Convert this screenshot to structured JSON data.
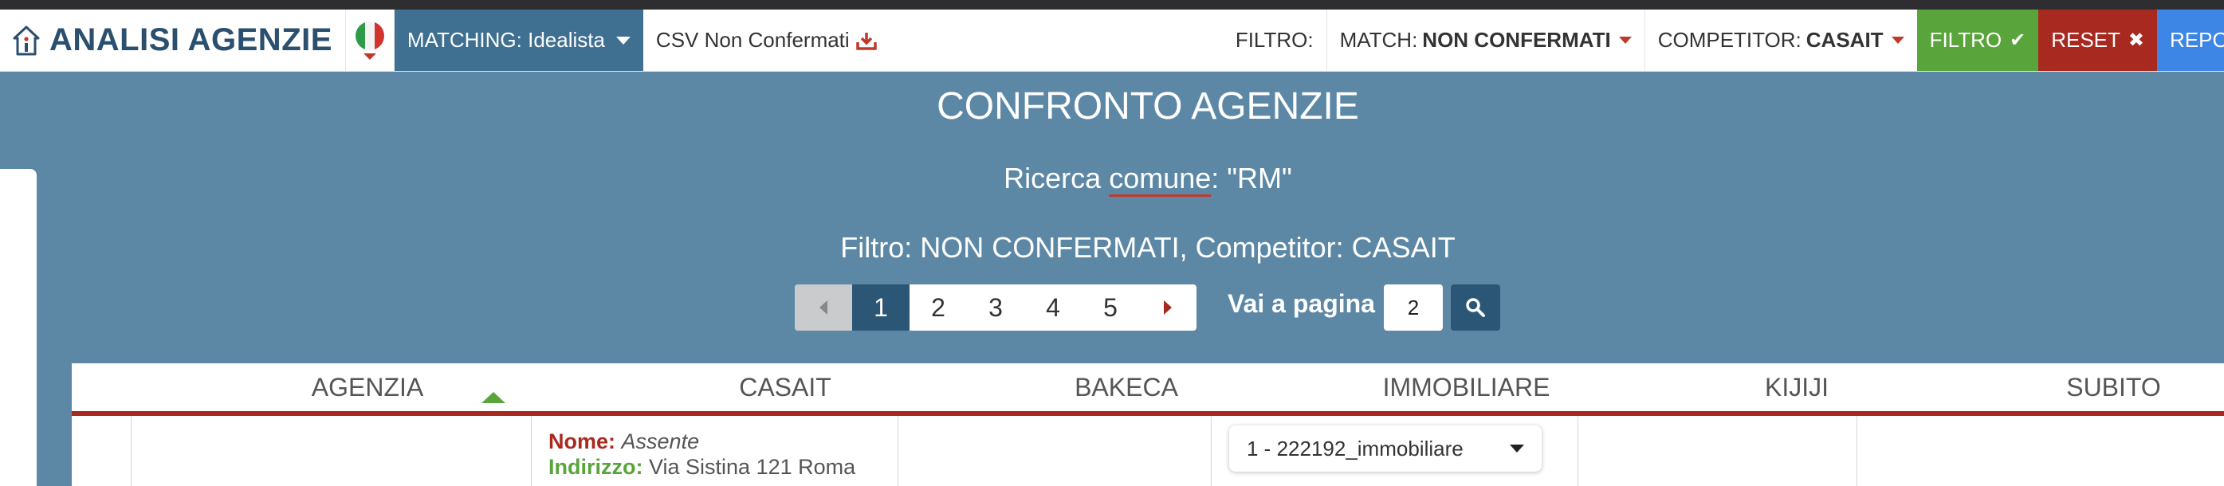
{
  "brand": {
    "title": "ANALISI AGENZIE",
    "icon": "home-info-icon"
  },
  "colors": {
    "navy": "#2b4f6e",
    "steel": "#5c88a6",
    "green": "#5aa43c",
    "red": "#a8291f",
    "blue": "#3d86e6"
  },
  "nav": {
    "matching_label": "MATCHING: Idealista",
    "csv_label": "CSV Non Confermati",
    "filtro_label": "FILTRO:",
    "match_key": "MATCH:",
    "match_value": "NON CONFERMATI",
    "competitor_key": "COMPETITOR:",
    "competitor_value": "CASAIT",
    "btn_filtro": "FILTRO",
    "btn_reset": "RESET",
    "btn_report": "REPORT"
  },
  "header": {
    "title": "CONFRONTO AGENZIE",
    "search_prefix": "Ricerca ",
    "search_word": "comune",
    "search_suffix": ": \"RM\"",
    "filter_line": "Filtro: NON CONFERMATI, Competitor: CASAIT"
  },
  "pagination": {
    "pages": [
      "1",
      "2",
      "3",
      "4",
      "5"
    ],
    "current_page": "1",
    "goto_label": "Vai a pagina",
    "goto_value": "2"
  },
  "table": {
    "columns": [
      "AGENZIA",
      "CASAIT",
      "BAKECA",
      "IMMOBILIARE",
      "KIJIJI",
      "SUBITO"
    ],
    "sort_column": "AGENZIA",
    "sort_direction": "ascending",
    "row1": {
      "casait_nome_key": "Nome:",
      "casait_nome_value": "Assente",
      "casait_indirizzo_key": "Indirizzo:",
      "casait_indirizzo_value": "Via Sistina 121 Roma",
      "immobiliare_select": "1 - 222192_immobiliare"
    }
  }
}
